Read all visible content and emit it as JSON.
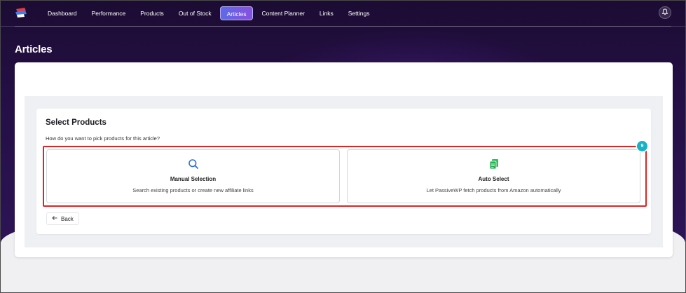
{
  "nav": {
    "items": [
      {
        "label": "Dashboard",
        "active": false
      },
      {
        "label": "Performance",
        "active": false
      },
      {
        "label": "Products",
        "active": false
      },
      {
        "label": "Out of Stock",
        "active": false
      },
      {
        "label": "Articles",
        "active": true
      },
      {
        "label": "Content Planner",
        "active": false
      },
      {
        "label": "Links",
        "active": false
      },
      {
        "label": "Settings",
        "active": false
      }
    ],
    "logo_icon": "app-logo-icon",
    "notification_icon": "bell-icon"
  },
  "page": {
    "title": "Articles"
  },
  "select_products": {
    "title": "Select Products",
    "question": "How do you want to pick products for this article?",
    "step_badge": "9",
    "options": [
      {
        "title": "Manual Selection",
        "description": "Search existing products or create new affiliate links",
        "icon": "search-icon",
        "icon_color": "#2f6fe0"
      },
      {
        "title": "Auto Select",
        "description": "Let PassiveWP fetch products from Amazon automatically",
        "icon": "documents-icon",
        "icon_color": "#2cbf5a"
      }
    ],
    "back_label": "Back"
  },
  "colors": {
    "header_bg": "#240f45",
    "active_tab": "#6a5ee6",
    "highlight_border": "#e02424",
    "badge": "#18b1c5"
  }
}
